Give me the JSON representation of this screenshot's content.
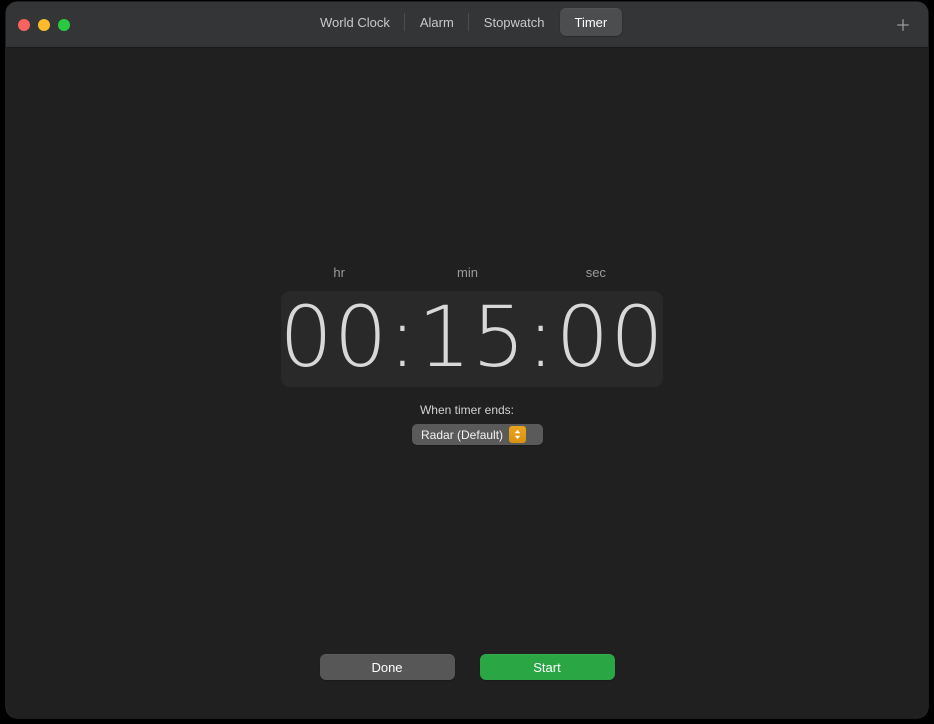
{
  "window": {
    "traffic_lights": [
      {
        "name": "close",
        "color": "#f7635f"
      },
      {
        "name": "minimize",
        "color": "#feba2d"
      },
      {
        "name": "zoom",
        "color": "#2bc940"
      }
    ]
  },
  "toolbar": {
    "tabs": [
      {
        "label": "World Clock",
        "selected": false
      },
      {
        "label": "Alarm",
        "selected": false
      },
      {
        "label": "Stopwatch",
        "selected": false
      },
      {
        "label": "Timer",
        "selected": true
      }
    ],
    "add_button_icon": "plus-icon"
  },
  "timer": {
    "unit_labels": [
      "hr",
      "min",
      "sec"
    ],
    "display": "00:15:00",
    "hours": "00",
    "minutes": "15",
    "seconds": "00",
    "when_ends_label": "When timer ends:",
    "sound": {
      "selected": "Radar (Default)",
      "options": [
        "Radar (Default)"
      ],
      "stepper_icon": "chevron-up-down-icon",
      "stepper_color": "#e09b17"
    }
  },
  "actions": {
    "done_label": "Done",
    "start_label": "Start",
    "done_color": "#575757",
    "start_color": "#2aa644"
  }
}
